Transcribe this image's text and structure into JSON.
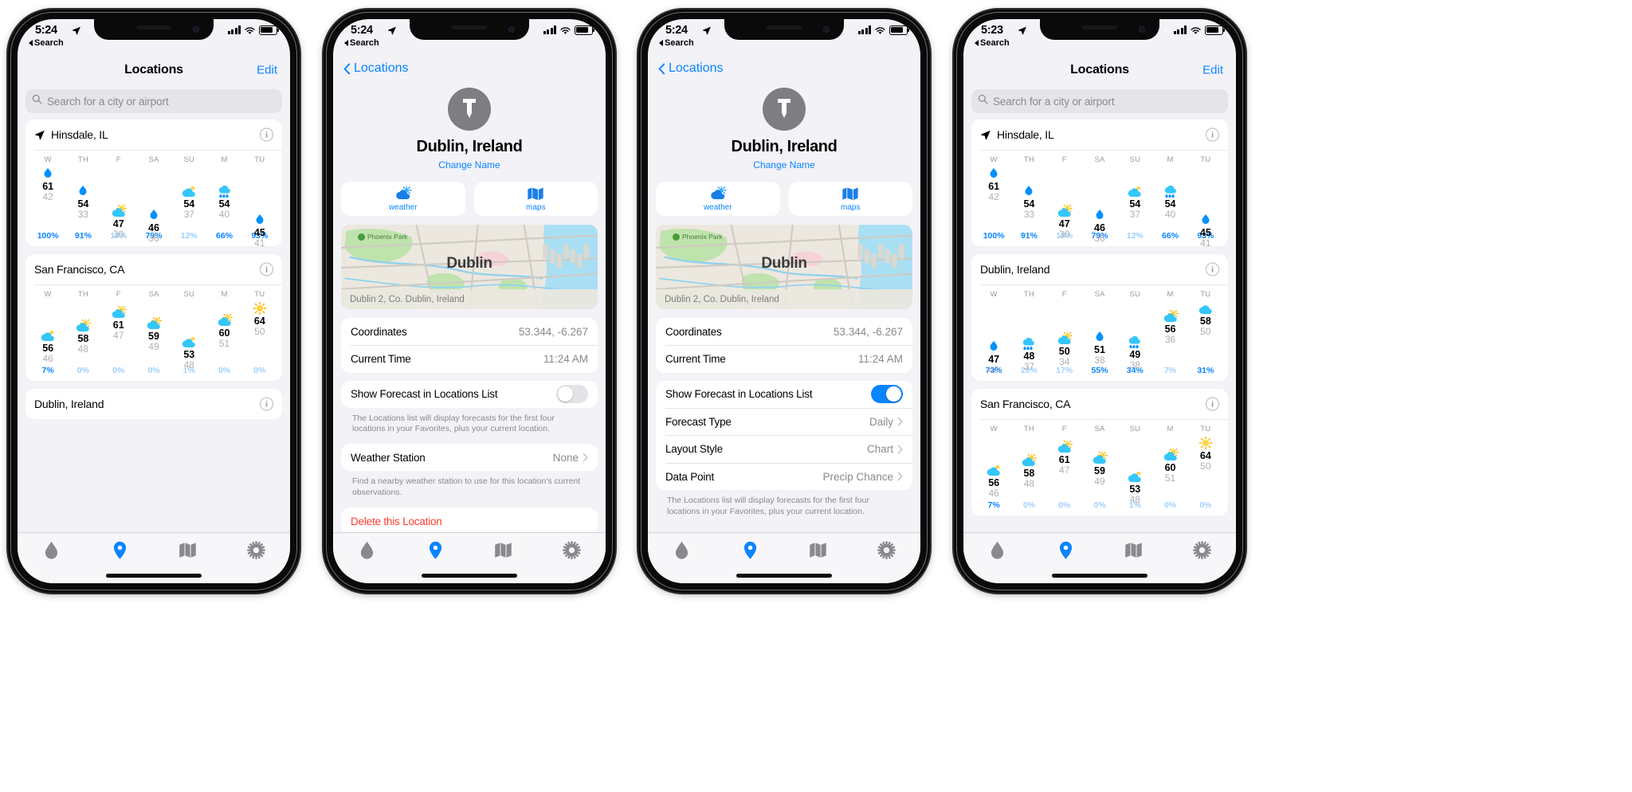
{
  "meta": {
    "accent_blue": "#0a84ff",
    "destructive_red": "#ff3b30",
    "bg_grouped": "#f2f2f7",
    "card_white": "#ffffff",
    "muted_gray": "#8a8a8e"
  },
  "panels": [
    {
      "id": "panel-locations-list",
      "status": {
        "time": "5:24",
        "back_app": "Search"
      },
      "nav": {
        "title": "Locations",
        "edit": "Edit",
        "back": null
      },
      "search": {
        "placeholder": "Search for a city or airport",
        "value": ""
      },
      "cards": [
        {
          "name": "Hinsdale, IL",
          "current_location": true,
          "forecast": {
            "days": [
              "W",
              "TH",
              "F",
              "SA",
              "SU",
              "M",
              "TU"
            ],
            "icons": [
              "rain",
              "rain",
              "partly-sunny",
              "rain",
              "partly-cloudy",
              "rain-cloud",
              "rain"
            ],
            "highs": [
              61,
              54,
              47,
              46,
              54,
              54,
              45
            ],
            "lows": [
              42,
              33,
              30,
              36,
              37,
              40,
              41
            ],
            "offsets": [
              0,
              22,
              47,
              52,
              22,
              22,
              58
            ],
            "percents": [
              "100%",
              "91%",
              "18%",
              "79%",
              "12%",
              "66%",
              "93%"
            ],
            "percent_strong": [
              true,
              true,
              false,
              true,
              false,
              true,
              true
            ]
          }
        },
        {
          "name": "San Francisco, CA",
          "current_location": false,
          "forecast": {
            "days": [
              "W",
              "TH",
              "F",
              "SA",
              "SU",
              "M",
              "TU"
            ],
            "icons": [
              "partly-cloudy",
              "partly-sunny",
              "partly-sunny",
              "partly-sunny",
              "partly-cloudy",
              "partly-sunny",
              "sunny"
            ],
            "highs": [
              56,
              58,
              61,
              59,
              53,
              60,
              64
            ],
            "lows": [
              46,
              48,
              47,
              49,
              48,
              51,
              50
            ],
            "offsets": [
              34,
              22,
              5,
              19,
              42,
              15,
              0
            ],
            "percents": [
              "7%",
              "0%",
              "0%",
              "0%",
              "1%",
              "0%",
              "0%"
            ],
            "percent_strong": [
              true,
              false,
              false,
              false,
              false,
              false,
              false
            ]
          }
        },
        {
          "name": "Dublin, Ireland",
          "current_location": false,
          "forecast": null
        }
      ],
      "tabs": [
        "drop-icon",
        "pin-icon",
        "map-icon",
        "gear-icon"
      ],
      "active_tab": 1
    },
    {
      "id": "panel-dublin-detail-off",
      "status": {
        "time": "5:24",
        "back_app": "Search"
      },
      "nav": {
        "back": "Locations"
      },
      "detail": {
        "avatar_icon": "pin-icon",
        "title": "Dublin, Ireland",
        "change_name": "Change Name",
        "apps": [
          {
            "label": "weather",
            "icon": "partly-sunny-icon"
          },
          {
            "label": "maps",
            "icon": "map-icon"
          }
        ],
        "map": {
          "city_label": "Dublin",
          "park_label": "Phoenix Park",
          "address": "Dublin 2, Co. Dublin, Ireland"
        },
        "rows_info": [
          {
            "label": "Coordinates",
            "value": "53.344, -6.267",
            "chevron": false
          },
          {
            "label": "Current Time",
            "value": "11:24 AM",
            "chevron": false
          }
        ],
        "toggle_row": {
          "label": "Show Forecast in Locations List",
          "on": false
        },
        "toggle_footer": "The Locations list will display forecasts for the first four locations in your Favorites, plus your current location.",
        "station_row": {
          "label": "Weather Station",
          "value": "None",
          "chevron": true
        },
        "station_footer": "Find a nearby weather station to use for this location's current observations.",
        "delete_row": {
          "label": "Delete this Location"
        },
        "extra_rows": []
      },
      "tabs": [
        "drop-icon",
        "pin-icon",
        "map-icon",
        "gear-icon"
      ],
      "active_tab": 1
    },
    {
      "id": "panel-dublin-detail-on",
      "status": {
        "time": "5:24",
        "back_app": "Search"
      },
      "nav": {
        "back": "Locations"
      },
      "detail": {
        "avatar_icon": "pin-icon",
        "title": "Dublin, Ireland",
        "change_name": "Change Name",
        "apps": [
          {
            "label": "weather",
            "icon": "partly-sunny-icon"
          },
          {
            "label": "maps",
            "icon": "map-icon"
          }
        ],
        "map": {
          "city_label": "Dublin",
          "park_label": "Phoenix Park",
          "address": "Dublin 2, Co. Dublin, Ireland"
        },
        "rows_info": [
          {
            "label": "Coordinates",
            "value": "53.344, -6.267",
            "chevron": false
          },
          {
            "label": "Current Time",
            "value": "11:24 AM",
            "chevron": false
          }
        ],
        "toggle_row": {
          "label": "Show Forecast in Locations List",
          "on": true
        },
        "toggle_footer": "The Locations list will display forecasts for the first four locations in your Favorites, plus your current location.",
        "station_row": null,
        "station_footer": null,
        "delete_row": null,
        "extra_rows": [
          {
            "label": "Forecast Type",
            "value": "Daily",
            "chevron": true
          },
          {
            "label": "Layout Style",
            "value": "Chart",
            "chevron": true
          },
          {
            "label": "Data Point",
            "value": "Precip Chance",
            "chevron": true
          }
        ]
      },
      "tabs": [
        "drop-icon",
        "pin-icon",
        "map-icon",
        "gear-icon"
      ],
      "active_tab": 1
    },
    {
      "id": "panel-locations-list-with-dublin",
      "status": {
        "time": "5:23",
        "back_app": "Search"
      },
      "nav": {
        "title": "Locations",
        "edit": "Edit",
        "back": null
      },
      "search": {
        "placeholder": "Search for a city or airport",
        "value": ""
      },
      "cards": [
        {
          "name": "Hinsdale, IL",
          "current_location": true,
          "forecast": {
            "days": [
              "W",
              "TH",
              "F",
              "SA",
              "SU",
              "M",
              "TU"
            ],
            "icons": [
              "rain",
              "rain",
              "partly-sunny",
              "rain",
              "partly-cloudy",
              "rain-cloud",
              "rain"
            ],
            "highs": [
              61,
              54,
              47,
              46,
              54,
              54,
              45
            ],
            "lows": [
              42,
              33,
              30,
              36,
              37,
              40,
              41
            ],
            "offsets": [
              0,
              22,
              47,
              52,
              22,
              22,
              58
            ],
            "percents": [
              "100%",
              "91%",
              "18%",
              "79%",
              "12%",
              "66%",
              "93%"
            ],
            "percent_strong": [
              true,
              true,
              false,
              true,
              false,
              true,
              true
            ]
          }
        },
        {
          "name": "Dublin, Ireland",
          "current_location": false,
          "forecast": {
            "days": [
              "W",
              "TH",
              "F",
              "SA",
              "SU",
              "M",
              "TU"
            ],
            "icons": [
              "rain",
              "rain-cloud",
              "partly-sunny",
              "rain",
              "rain-cloud",
              "partly-sunny",
              "cloudy"
            ],
            "highs": [
              47,
              48,
              50,
              51,
              49,
              56,
              58
            ],
            "lows": [
              40,
              37,
              34,
              38,
              38,
              36,
              50
            ],
            "offsets": [
              48,
              44,
              38,
              36,
              42,
              10,
              0
            ],
            "percents": [
              "73%",
              "28%",
              "17%",
              "55%",
              "34%",
              "7%",
              "31%"
            ],
            "percent_strong": [
              true,
              false,
              false,
              true,
              true,
              false,
              true
            ]
          }
        },
        {
          "name": "San Francisco, CA",
          "current_location": false,
          "forecast": {
            "days": [
              "W",
              "TH",
              "F",
              "SA",
              "SU",
              "M",
              "TU"
            ],
            "icons": [
              "partly-cloudy",
              "partly-sunny",
              "partly-sunny",
              "partly-sunny",
              "partly-cloudy",
              "partly-sunny",
              "sunny"
            ],
            "highs": [
              56,
              58,
              61,
              59,
              53,
              60,
              64
            ],
            "lows": [
              46,
              48,
              47,
              49,
              48,
              51,
              50
            ],
            "offsets": [
              34,
              22,
              5,
              19,
              42,
              15,
              0
            ],
            "percents": [
              "7%",
              "0%",
              "0%",
              "0%",
              "1%",
              "0%",
              "0%"
            ],
            "percent_strong": [
              true,
              false,
              false,
              false,
              false,
              false,
              false
            ]
          }
        }
      ],
      "tabs": [
        "drop-icon",
        "pin-icon",
        "map-icon",
        "gear-icon"
      ],
      "active_tab": 1
    }
  ]
}
